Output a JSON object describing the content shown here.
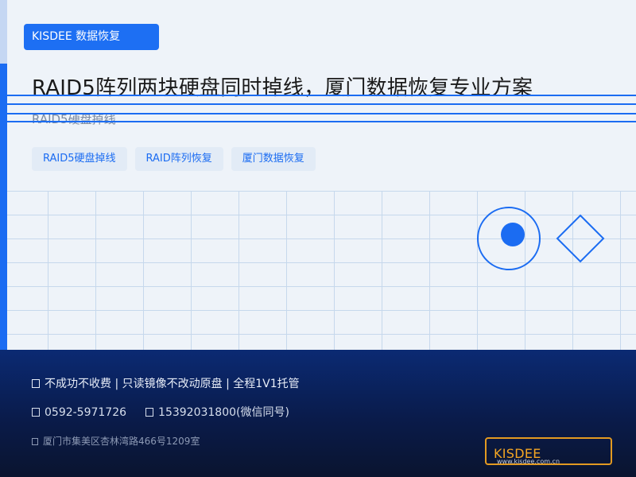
{
  "header": {
    "brand_tag": "KISDEE 数据恢复",
    "title": "RAID5阵列两块硬盘同时掉线，厦门数据恢复专业方案",
    "subtitle": "RAID5硬盘掉线"
  },
  "tags": [
    {
      "label": "RAID5硬盘掉线"
    },
    {
      "label": "RAID阵列恢复"
    },
    {
      "label": "厦门数据恢复"
    }
  ],
  "footer": {
    "promise_icon": "check-icon",
    "promise_text": "不成功不收费  |  只读镜像不改动原盘  |  全程1V1托管",
    "phone_icon": "phone-icon",
    "phone": "0592-5971726",
    "mobile_icon": "mobile-icon",
    "mobile": "15392031800(微信同号)",
    "address_icon": "location-pin-icon",
    "address": "厦门市集美区杏林湾路466号1209室"
  },
  "logo": {
    "name": "KISDEE",
    "url": "www.kisdee.com.cn"
  },
  "colors": {
    "accent": "#1b6cf2",
    "footer_bg": "#0a1b4a",
    "logo_orange": "#f5a623"
  }
}
